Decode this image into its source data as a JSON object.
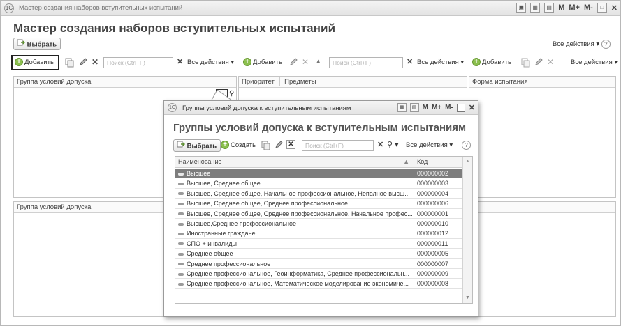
{
  "window": {
    "title": "Мастер создания наборов вступительных испытаний",
    "controls": [
      "M",
      "M+",
      "M-"
    ]
  },
  "page": {
    "title": "Мастер создания наборов вступительных испытаний",
    "select_button": "Выбрать",
    "all_actions": "Все действия"
  },
  "toolbar_left": {
    "add_label": "Добавить",
    "search_placeholder": "Поиск (Ctrl+F)",
    "all_actions": "Все действия"
  },
  "toolbar_middle": {
    "add_label": "Добавить",
    "search_placeholder": "Поиск (Ctrl+F)",
    "all_actions": "Все действия"
  },
  "toolbar_right": {
    "add_label": "Добавить",
    "all_actions": "Все действия"
  },
  "panels": {
    "groups_header": "Группа условий допуска",
    "priority_header": "Приоритет",
    "subjects_header": "Предметы",
    "form_header": "Форма испытания",
    "lower_groups_header": "Группа условий допуска"
  },
  "popup": {
    "title": "Группы условий допуска к вступительным испытаниям",
    "heading": "Группы условий допуска к вступительным испытаниям",
    "select_button": "Выбрать",
    "create_button": "Создать",
    "search_placeholder": "Поиск (Ctrl+F)",
    "all_actions": "Все действия",
    "controls": [
      "M",
      "M+",
      "M-"
    ],
    "columns": {
      "name": "Наименование",
      "code": "Код"
    },
    "rows": [
      {
        "name": "Высшее",
        "code": "000000002"
      },
      {
        "name": "Высшее, Среднее общее",
        "code": "000000003"
      },
      {
        "name": "Высшее, Среднее общее, Начальное профессиональное, Неполное высш...",
        "code": "000000004"
      },
      {
        "name": "Высшее, Среднее общее, Среднее профессиональное",
        "code": "000000006"
      },
      {
        "name": "Высшее, Среднее общее, Среднее профессиональное, Начальное профес...",
        "code": "000000001"
      },
      {
        "name": "Высшее,Среднее профессиональное",
        "code": "000000010"
      },
      {
        "name": "Иностранные граждане",
        "code": "000000012"
      },
      {
        "name": "СПО + инвалиды",
        "code": "000000011"
      },
      {
        "name": "Среднее общее",
        "code": "000000005"
      },
      {
        "name": "Среднее профессиональное",
        "code": "000000007"
      },
      {
        "name": "Среднее профессиональное, Геоинформатика, Среднее профессиональн...",
        "code": "000000009"
      },
      {
        "name": "Среднее профессиональное, Математическое моделирование экономиче...",
        "code": "000000008"
      }
    ]
  }
}
